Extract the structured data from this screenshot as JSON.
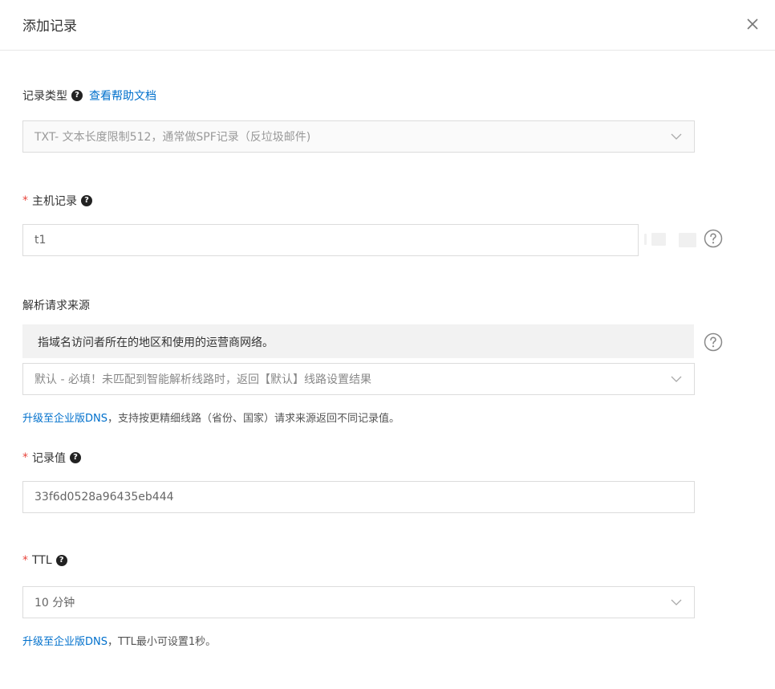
{
  "dialog": {
    "title": "添加记录"
  },
  "record_type": {
    "label": "记录类型",
    "help_link": "查看帮助文档",
    "selected": "TXT- 文本长度限制512，通常做SPF记录（反垃圾邮件)"
  },
  "host_record": {
    "required_mark": "*",
    "label": "主机记录",
    "value": "t1"
  },
  "resolve_source": {
    "label": "解析请求来源",
    "tooltip": "指域名访问者所在的地区和使用的运营商网络。",
    "selected": "默认 - 必填！未匹配到智能解析线路时，返回【默认】线路设置结果",
    "upgrade_link": "升级至企业版DNS",
    "upgrade_text": "，支持按更精细线路（省份、国家）请求来源返回不同记录值。"
  },
  "record_value": {
    "required_mark": "*",
    "label": "记录值",
    "value": "33f6d0528a96435eb444"
  },
  "ttl": {
    "required_mark": "*",
    "label": "TTL",
    "selected": "10 分钟",
    "upgrade_link": "升级至企业版DNS",
    "upgrade_text": "，TTL最小可设置1秒。"
  },
  "icons": {
    "close": "close-icon",
    "help_filled": "question-filled-icon",
    "help_outline": "question-circle-icon",
    "dropdown": "chevron-down-icon"
  },
  "colors": {
    "link": "#0070cc",
    "required": "#e8453c",
    "border": "#dcdcdc",
    "tooltip_bg": "#f2f2f2"
  }
}
